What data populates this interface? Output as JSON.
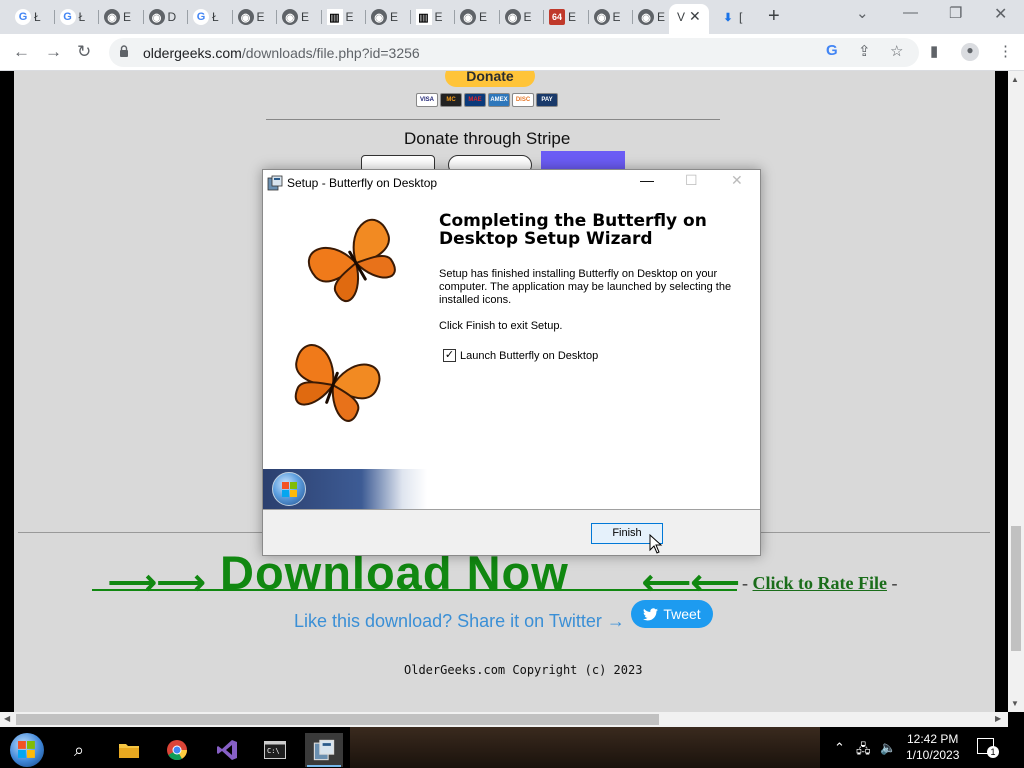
{
  "browser": {
    "tabs": [
      {
        "label": "Ł",
        "favicon": "google-icon"
      },
      {
        "label": "Ł",
        "favicon": "google-icon"
      },
      {
        "label": "E",
        "favicon": "globe-icon"
      },
      {
        "label": "D",
        "favicon": "globe-icon"
      },
      {
        "label": "Ł",
        "favicon": "google-icon"
      },
      {
        "label": "E",
        "favicon": "globe-icon"
      },
      {
        "label": "E",
        "favicon": "globe-icon"
      },
      {
        "label": "E",
        "favicon": "archive-icon"
      },
      {
        "label": "E",
        "favicon": "globe-icon"
      },
      {
        "label": "E",
        "favicon": "archive-icon"
      },
      {
        "label": "E",
        "favicon": "globe-icon"
      },
      {
        "label": "E",
        "favicon": "globe-icon"
      },
      {
        "label": "E",
        "favicon": "sixtyfour-icon"
      },
      {
        "label": "E",
        "favicon": "globe-icon"
      },
      {
        "label": "E",
        "favicon": "globe-icon"
      }
    ],
    "active_tab": {
      "label": "V"
    },
    "download_tab": {
      "label": "["
    },
    "new_tab": "+",
    "url_host": "oldergeeks.com",
    "url_path": "/downloads/file.php?id=3256"
  },
  "page": {
    "donate_label": "Donate",
    "cards": [
      "VISA",
      "MC",
      "MAE",
      "AMEX",
      "DISC",
      "PAY"
    ],
    "stripe_title": "Donate through Stripe",
    "download_now": "Download Now",
    "arrows_left": "⟶⟶",
    "arrows_right": "⟵⟵",
    "rate_prefix": "- ",
    "rate_link": "Click to Rate File",
    "rate_suffix": " -",
    "share_text": "Like this download? Share it on Twitter →",
    "tweet_label": "Tweet",
    "copyright": "OlderGeeks.com Copyright (c) 2023"
  },
  "dialog": {
    "title": "Setup - Butterfly on Desktop",
    "heading": "Completing the Butterfly on Desktop Setup Wizard",
    "paragraph1": "Setup has finished installing Butterfly on Desktop on your computer. The application may be launched by selecting the installed icons.",
    "paragraph2": "Click Finish to exit Setup.",
    "checkbox_label": "Launch Butterfly on Desktop",
    "checkbox_checked": true,
    "finish_label": "Finish"
  },
  "taskbar": {
    "time": "12:42 PM",
    "date": "1/10/2023",
    "notification_count": "1",
    "accent": "#76b9ed"
  }
}
